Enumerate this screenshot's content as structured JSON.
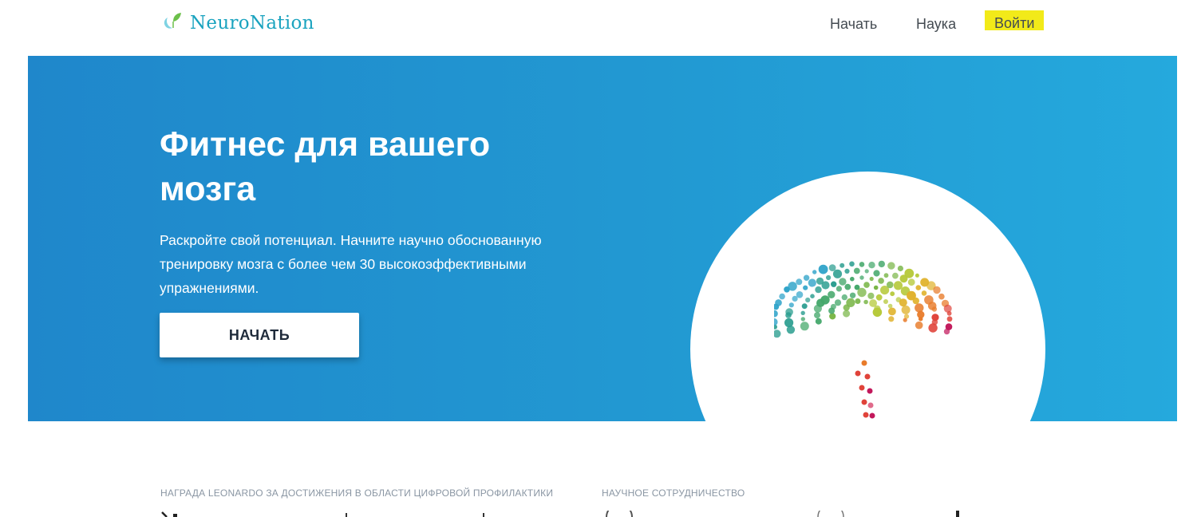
{
  "header": {
    "logo_text": "NeuroNation",
    "nav": {
      "start": "Начать",
      "science": "Наука",
      "login": "Войти"
    }
  },
  "hero": {
    "title": "Фитнес для вашего мозга",
    "subtitle": "Раскройте свой потенциал. Начните научно обоснованную тренировку мозга с более чем 30 высокоэффективными упражнениями.",
    "cta_label": "НАЧАТЬ"
  },
  "awards": {
    "leonardo_heading": "НАГРАДА LEONARDO ЗА ДОСТИЖЕНИЯ В ОБЛАСТИ ЦИФРОВОЙ ПРОФИЛАКТИКИ",
    "science_heading": "НАУЧНОЕ СОТРУДНИЧЕСТВО"
  },
  "colors": {
    "hero_gradient_start": "#1f87cb",
    "hero_gradient_end": "#25a9dd",
    "login_highlight": "#f2ea19",
    "logo_teal": "#1aa3bf",
    "logo_green": "#6cc04a"
  },
  "icons": {
    "logo": "neuronation-logo-icon",
    "brain": "brain-dots-icon"
  }
}
